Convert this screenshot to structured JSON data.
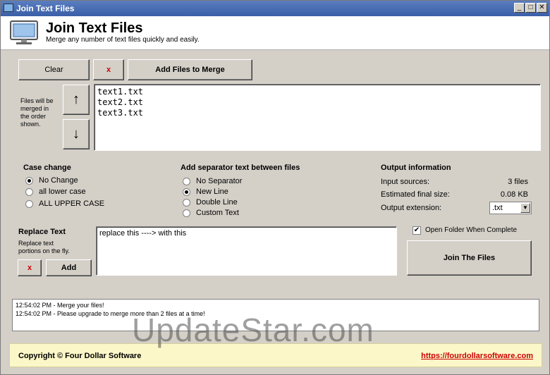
{
  "window": {
    "title": "Join Text Files",
    "controls": {
      "minimize": "_",
      "maximize": "□",
      "close": "✕"
    }
  },
  "header": {
    "title": "Join Text Files",
    "subtitle": "Merge any number of text files quickly and easily.",
    "icon": "monitor-icon"
  },
  "file_buttons": {
    "clear": "Clear",
    "remove": "x",
    "add": "Add Files to Merge"
  },
  "order_note": [
    "Files will be",
    "merged in",
    "the order",
    "shown."
  ],
  "move_buttons": {
    "up": "↑",
    "down": "↓"
  },
  "files": [
    "text1.txt",
    "text2.txt",
    "text3.txt"
  ],
  "case_change": {
    "title": "Case change",
    "options": [
      "No Change",
      "all lower case",
      "ALL UPPER CASE"
    ],
    "selected": "No Change"
  },
  "separator": {
    "title": "Add separator text between files",
    "options": [
      "No Separator",
      "New Line",
      "Double Line",
      "Custom Text"
    ],
    "selected": "New Line"
  },
  "output": {
    "title": "Output information",
    "input_sources_label": "Input sources:",
    "input_sources_value": "3 files",
    "size_label": "Estimated final size:",
    "size_value": "0.08 KB",
    "ext_label": "Output extension:",
    "ext_value": ".txt"
  },
  "replace": {
    "title": "Replace Text",
    "note": [
      "Replace text",
      "portions on the fly."
    ],
    "remove": "x",
    "add": "Add",
    "text": "replace this ----> with this"
  },
  "open_folder": {
    "label": "Open Folder When Complete",
    "checked": true
  },
  "join_button": "Join The Files",
  "log": [
    "12:54:02 PM - Merge your files!",
    "12:54:02 PM - Please upgrade to merge more than 2 files at a time!"
  ],
  "footer": {
    "copyright": "Copyright © Four Dollar Software",
    "link": "https://fourdollarsoftware.com"
  },
  "watermark": "UpdateStar.com"
}
